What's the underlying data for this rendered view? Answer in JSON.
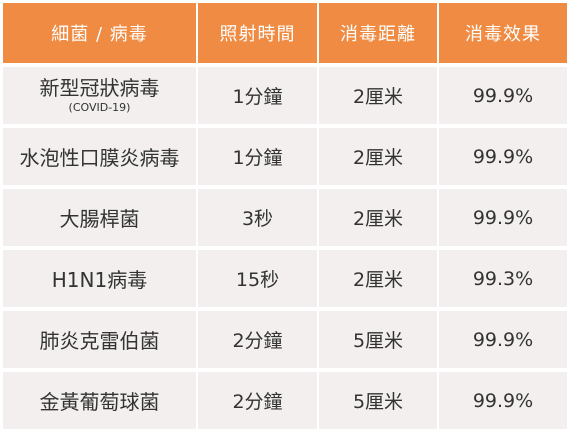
{
  "colors": {
    "header_bg": "#EF8B42",
    "header_text": "#FFFFFF",
    "row_bg": "#F2EFEE",
    "body_text": "#333333"
  },
  "chart_data": {
    "type": "table",
    "columns": [
      "細菌 / 病毒",
      "照射時間",
      "消毒距離",
      "消毒效果"
    ],
    "rows": [
      {
        "pathogen": "新型冠狀病毒",
        "pathogen_note": "(COVID-19)",
        "irradiation_time": "1分鐘",
        "distance": "2厘米",
        "effect": "99.9%"
      },
      {
        "pathogen": "水泡性口膜炎病毒",
        "irradiation_time": "1分鐘",
        "distance": "2厘米",
        "effect": "99.9%"
      },
      {
        "pathogen": "大腸桿菌",
        "irradiation_time": "3秒",
        "distance": "2厘米",
        "effect": "99.9%"
      },
      {
        "pathogen": "H1N1病毒",
        "irradiation_time": "15秒",
        "distance": "2厘米",
        "effect": "99.3%"
      },
      {
        "pathogen": "肺炎克雷伯菌",
        "irradiation_time": "2分鐘",
        "distance": "5厘米",
        "effect": "99.9%"
      },
      {
        "pathogen": "金黃葡萄球菌",
        "irradiation_time": "2分鐘",
        "distance": "5厘米",
        "effect": "99.9%"
      }
    ]
  }
}
